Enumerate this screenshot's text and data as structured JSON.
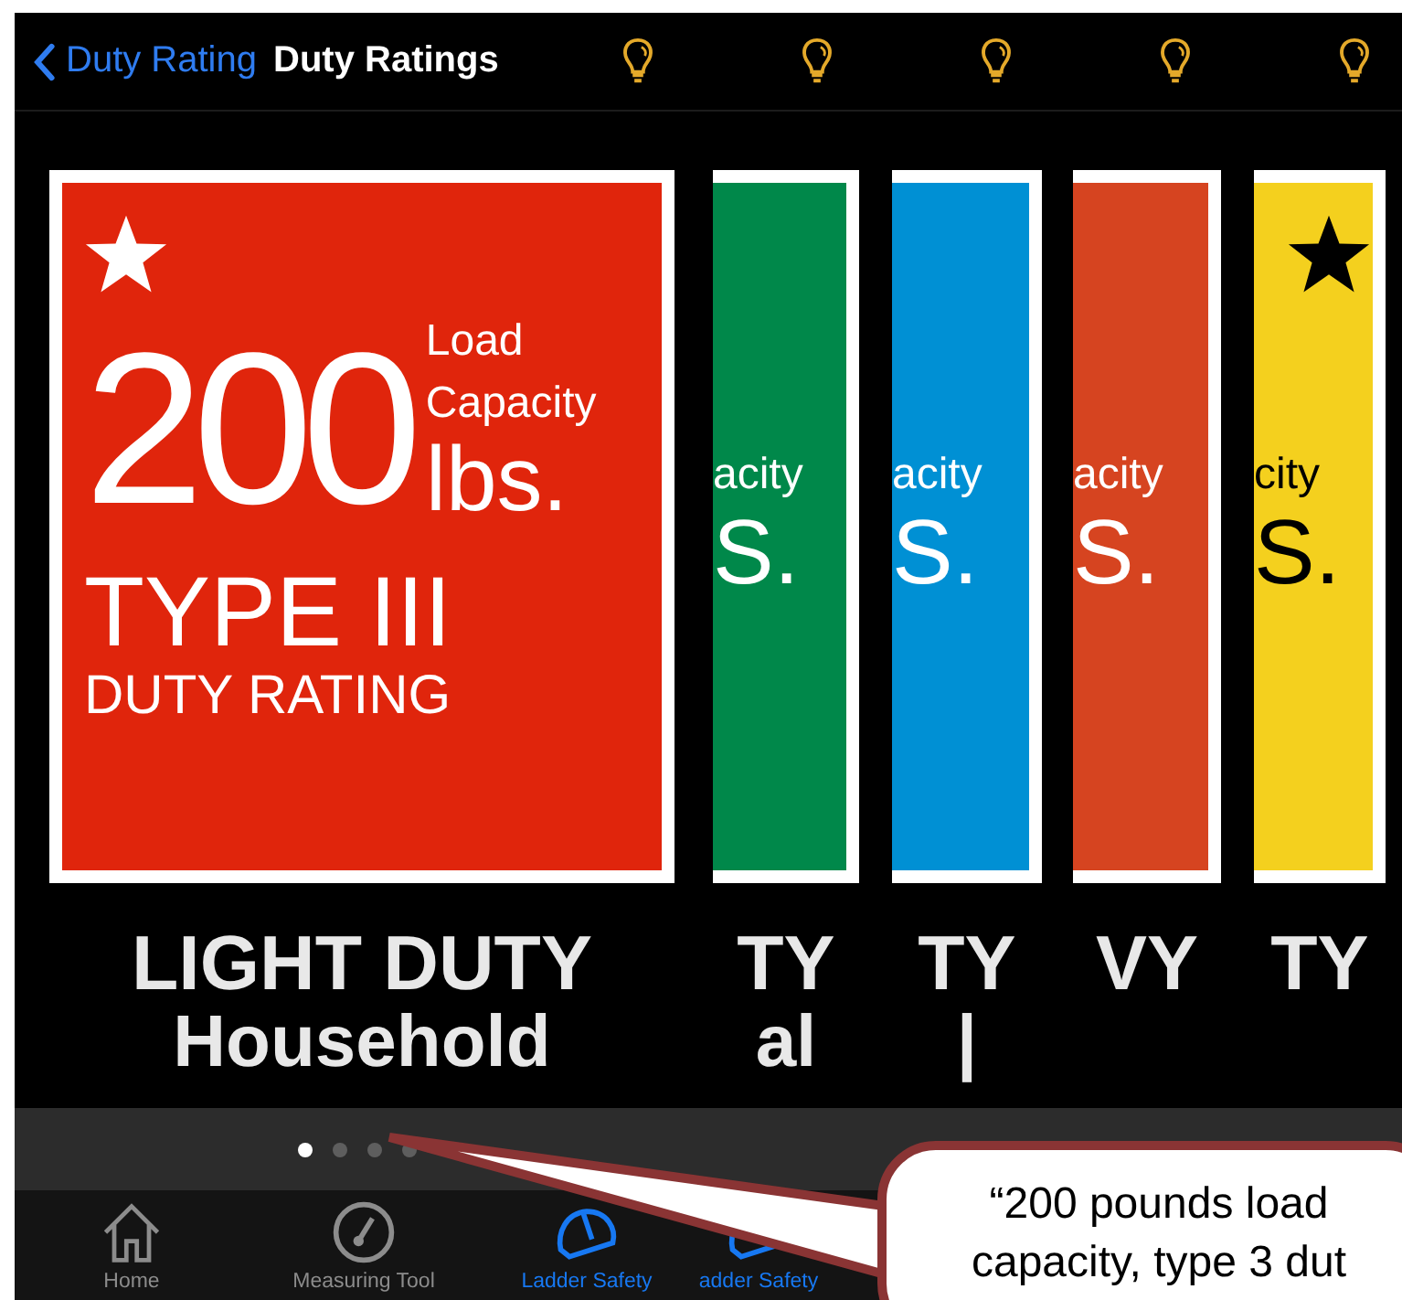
{
  "nav": {
    "back_label": "Duty Rating",
    "title": "Duty Ratings"
  },
  "cards": [
    {
      "kind": "full",
      "color": "#e0250c",
      "dark_text": false,
      "star": true,
      "number": "200",
      "load_label": "Load",
      "capacity_label": "Capacity",
      "unit": "lbs.",
      "type": "TYPE III",
      "rating": "DUTY RATING",
      "title": "LIGHT DUTY",
      "subtitle": "Household"
    },
    {
      "kind": "partial",
      "color": "#00884a",
      "dark_text": false,
      "star": false,
      "capacity_label": "acity",
      "unit": "S.",
      "title": "TY",
      "subtitle": "al"
    },
    {
      "kind": "partial",
      "color": "#0090d4",
      "dark_text": false,
      "star": false,
      "capacity_label": "acity",
      "unit": "S.",
      "title": "TY",
      "subtitle": "|"
    },
    {
      "kind": "partial",
      "color": "#d64420",
      "dark_text": false,
      "star": false,
      "capacity_label": "acity",
      "unit": "S.",
      "title": "VY"
    },
    {
      "kind": "partial",
      "color": "#f4d01e",
      "dark_text": true,
      "star": true,
      "capacity_label": "city",
      "unit": "S.",
      "title": "TY"
    }
  ],
  "page_dots": [
    {
      "selected": true
    },
    {
      "selected": false
    },
    {
      "selected": false
    },
    {
      "selected": false
    }
  ],
  "tabs": [
    {
      "kind": "home",
      "label": "Home",
      "selected": false
    },
    {
      "kind": "gauge",
      "label": "Measuring Tool",
      "selected": false
    },
    {
      "kind": "helmet",
      "label": "Ladder Safety",
      "selected": true
    },
    {
      "kind": "helmet",
      "label": "adder Safety",
      "selected": true
    }
  ],
  "callout": {
    "text": "“200 pounds load\ncapacity, type 3 dut"
  }
}
